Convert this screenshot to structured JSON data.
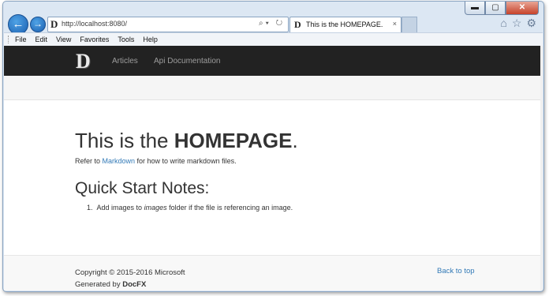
{
  "window": {
    "controls": {
      "minimize": "▬",
      "maximize": "▢",
      "close": "✕"
    }
  },
  "browser": {
    "back_icon": "←",
    "forward_icon": "→",
    "address": {
      "favicon": "D",
      "url": "http://localhost:8080/",
      "tools": "⌕▾ ↻"
    },
    "tab": {
      "favicon": "D",
      "title": "This is the HOMEPAGE.",
      "close": "×"
    },
    "right_icons": {
      "home": "⌂",
      "favorites": "☆",
      "settings": "⚙"
    }
  },
  "menu": {
    "items": [
      "File",
      "Edit",
      "View",
      "Favorites",
      "Tools",
      "Help"
    ]
  },
  "site": {
    "logo": "D",
    "nav": [
      "Articles",
      "Api Documentation"
    ]
  },
  "article": {
    "title_pre": "This is the ",
    "title_bold": "HOMEPAGE",
    "title_post": ".",
    "intro_pre": "Refer to ",
    "intro_link": "Markdown",
    "intro_post": " for how to write markdown files.",
    "section_heading": "Quick Start Notes:",
    "list_num": "1.",
    "list_pre": "Add images to ",
    "list_em": "images",
    "list_post": " folder if the file is referencing an image."
  },
  "footer": {
    "copyright": "Copyright © 2015-2016 Microsoft",
    "generated_pre": "Generated by ",
    "generated_bold": "DocFX",
    "back_to_top": "Back to top"
  },
  "colors": {
    "navbar_bg": "#222222",
    "link": "#337ab7"
  }
}
